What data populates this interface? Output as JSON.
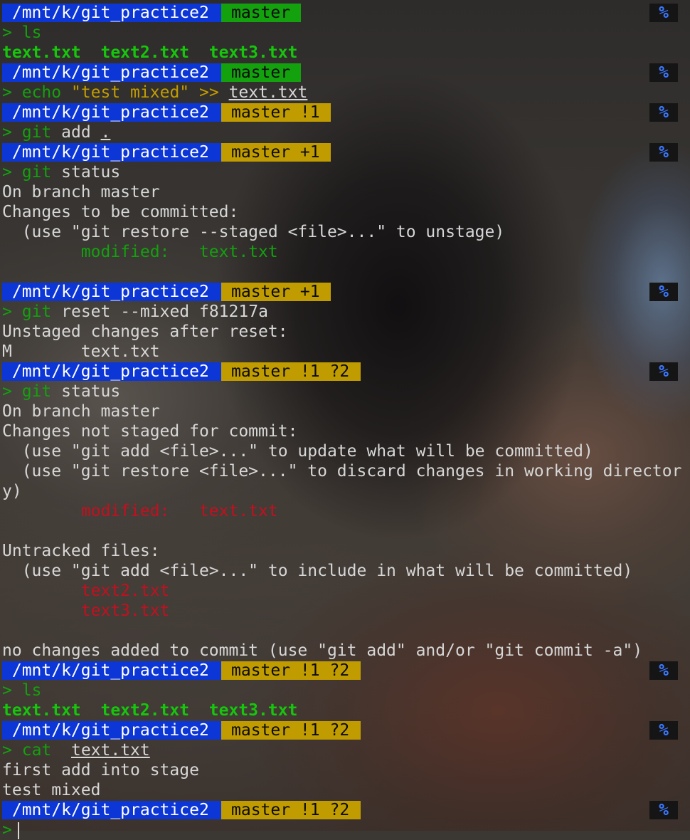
{
  "colors": {
    "path_bg": "#0d36d6",
    "git_clean_bg": "#13a10e",
    "git_dirty_bg": "#c19c00",
    "green": "#13a10e",
    "red": "#c50f1f",
    "percent": "#3b78ff"
  },
  "prompt": {
    "path": " /mnt/k/git_practice2",
    "percent": "%",
    "caret": ">"
  },
  "git": {
    "clean": "master",
    "mod1": "master !1",
    "staged1": "master +1",
    "mod1_untracked2": "master !1 ?2"
  },
  "block1": {
    "cmd": "ls",
    "files": "text.txt  text2.txt  text3.txt"
  },
  "block2": {
    "cmd": "echo",
    "arg": "\"test mixed\"",
    "op": ">>",
    "file": "text.txt"
  },
  "block3": {
    "cmd": "git",
    "args": "add",
    "dot": "."
  },
  "block4": {
    "cmd": "git",
    "args": "status",
    "out1": "On branch master",
    "out2": "Changes to be committed:",
    "out3": "  (use \"git restore --staged <file>...\" to unstage)",
    "modified_label": "        modified:   ",
    "modified_file": "text.txt"
  },
  "block5": {
    "cmd": "git",
    "args": "reset --mixed f81217a",
    "out1": "Unstaged changes after reset:",
    "out2": "M       text.txt"
  },
  "block6": {
    "cmd": "git",
    "args": "status",
    "out1": "On branch master",
    "out2": "Changes not staged for commit:",
    "out3": "  (use \"git add <file>...\" to update what will be committed)",
    "out4": "  (use \"git restore <file>...\" to discard changes in working director",
    "out5": "y)",
    "modified_label": "        modified:   ",
    "modified_file": "text.txt",
    "untracked_header": "Untracked files:",
    "untracked_hint": "  (use \"git add <file>...\" to include in what will be committed)",
    "untracked1": "        text2.txt",
    "untracked2": "        text3.txt",
    "summary": "no changes added to commit (use \"git add\" and/or \"git commit -a\")"
  },
  "block7": {
    "cmd": "ls",
    "files": "text.txt  text2.txt  text3.txt"
  },
  "block8": {
    "cmd": "cat",
    "file": "text.txt",
    "out1": "first add into stage",
    "out2": "test mixed"
  }
}
